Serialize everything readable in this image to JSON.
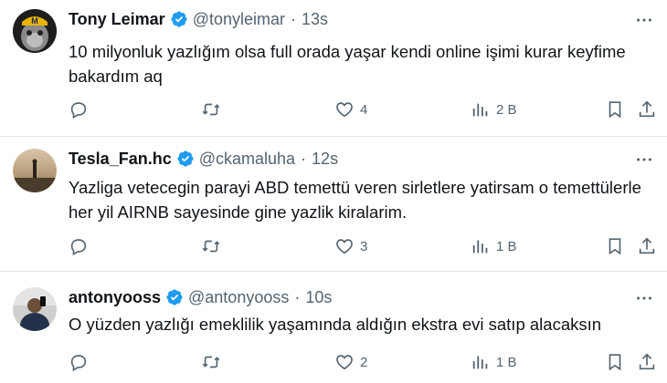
{
  "tweets": [
    {
      "name": "Tony Leimar",
      "handle": "@tonyleimar",
      "separator": "·",
      "time": "13s",
      "text": "10 milyonluk yazlığım olsa full orada yaşar kendi online işimi kurar keyfime bakardım aq",
      "likes": "4",
      "views": "2 B"
    },
    {
      "name": "Tesla_Fan.hc",
      "handle": "@ckamaluha",
      "separator": "·",
      "time": "12s",
      "text": "Yazliga vetecegin parayi ABD temettü veren sirletlere yatirsam o temettülerle her yil AIRNB sayesinde gine yazlik kiralarim.",
      "likes": "3",
      "views": "1 B"
    },
    {
      "name": "antonyooss",
      "handle": "@antonyooss",
      "separator": "·",
      "time": "10s",
      "text": "O yüzden yazlığı emeklilik yaşamında aldığın ekstra evi satıp alacaksın",
      "likes": "2",
      "views": "1 B"
    }
  ],
  "colors": {
    "verified": "#1d9bf0",
    "muted": "#536471",
    "text": "#0f1419",
    "divider": "#e1e8ed"
  }
}
